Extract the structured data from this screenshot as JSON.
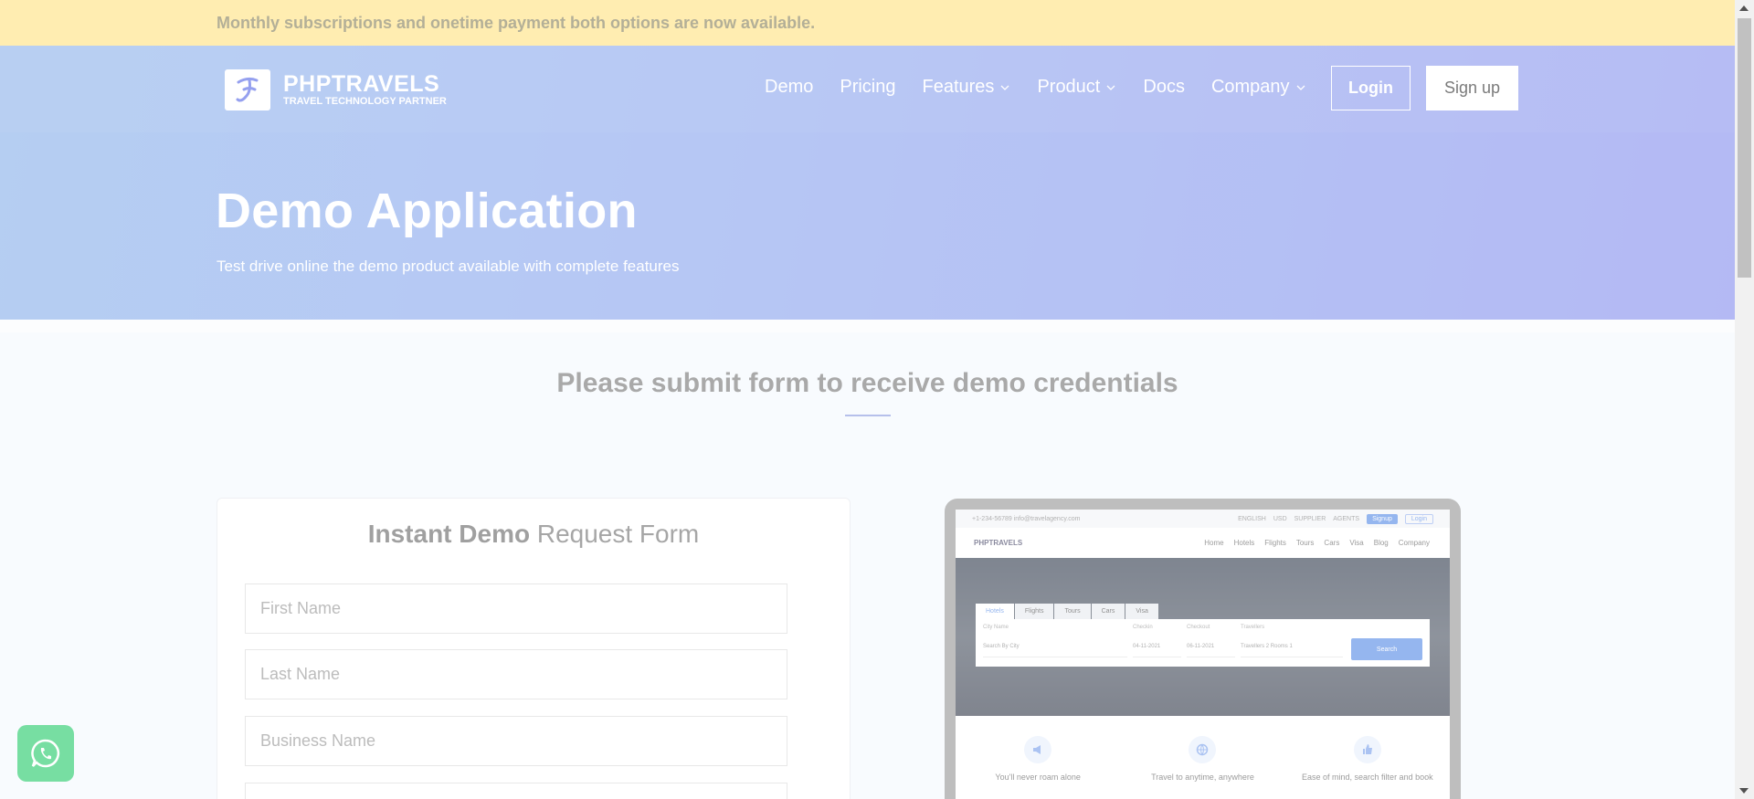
{
  "announcement": "Monthly subscriptions and onetime payment both options are now available.",
  "brand": {
    "name": "PHPTRAVELS",
    "tagline": "TRAVEL TECHNOLOGY PARTNER",
    "logo_icon": "phptravels-logo-icon"
  },
  "nav": {
    "items": [
      {
        "label": "Demo",
        "dropdown": false
      },
      {
        "label": "Pricing",
        "dropdown": false
      },
      {
        "label": "Features",
        "dropdown": true
      },
      {
        "label": "Product",
        "dropdown": true
      },
      {
        "label": "Docs",
        "dropdown": false
      },
      {
        "label": "Company",
        "dropdown": true
      }
    ],
    "login": "Login",
    "signup": "Sign up"
  },
  "hero": {
    "title": "Demo Application",
    "subtitle": "Test drive online the demo product available with complete features"
  },
  "section": {
    "title": "Please submit form to receive demo credentials"
  },
  "form": {
    "title_bold": "Instant Demo",
    "title_light": "Request Form",
    "fields": [
      {
        "placeholder": "First Name",
        "value": ""
      },
      {
        "placeholder": "Last Name",
        "value": ""
      },
      {
        "placeholder": "Business Name",
        "value": ""
      }
    ]
  },
  "preview": {
    "topbar_left": "+1-234-56789   info@travelagency.com",
    "topbar_items": [
      "ENGLISH",
      "USD",
      "SUPPLIER",
      "AGENTS"
    ],
    "signup": "Signup",
    "login": "Login",
    "brand": "PHPTRAVELS",
    "links": [
      "Home",
      "Hotels",
      "Flights",
      "Tours",
      "Cars",
      "Visa",
      "Blog",
      "Company"
    ],
    "tabs": [
      "Hotels",
      "Flights",
      "Tours",
      "Cars",
      "Visa"
    ],
    "search": {
      "city_label": "City Name",
      "city_placeholder": "Search By City",
      "checkin_label": "Checkin",
      "checkin_value": "04-11-2021",
      "checkout_label": "Checkout",
      "checkout_value": "06-11-2021",
      "travellers_label": "Travellers",
      "travellers_value": "Travellers 2 Rooms 1",
      "button": "Search"
    },
    "features": [
      "You'll never roam alone",
      "Travel to anytime, anywhere",
      "Ease of mind, search filter and book"
    ]
  },
  "colors": {
    "announcement_bg": "#ffe387",
    "hero_start": "#8eb4ec",
    "hero_end": "#8c94ee",
    "accent": "#5d8fe6",
    "whatsapp": "#2ecc71"
  }
}
